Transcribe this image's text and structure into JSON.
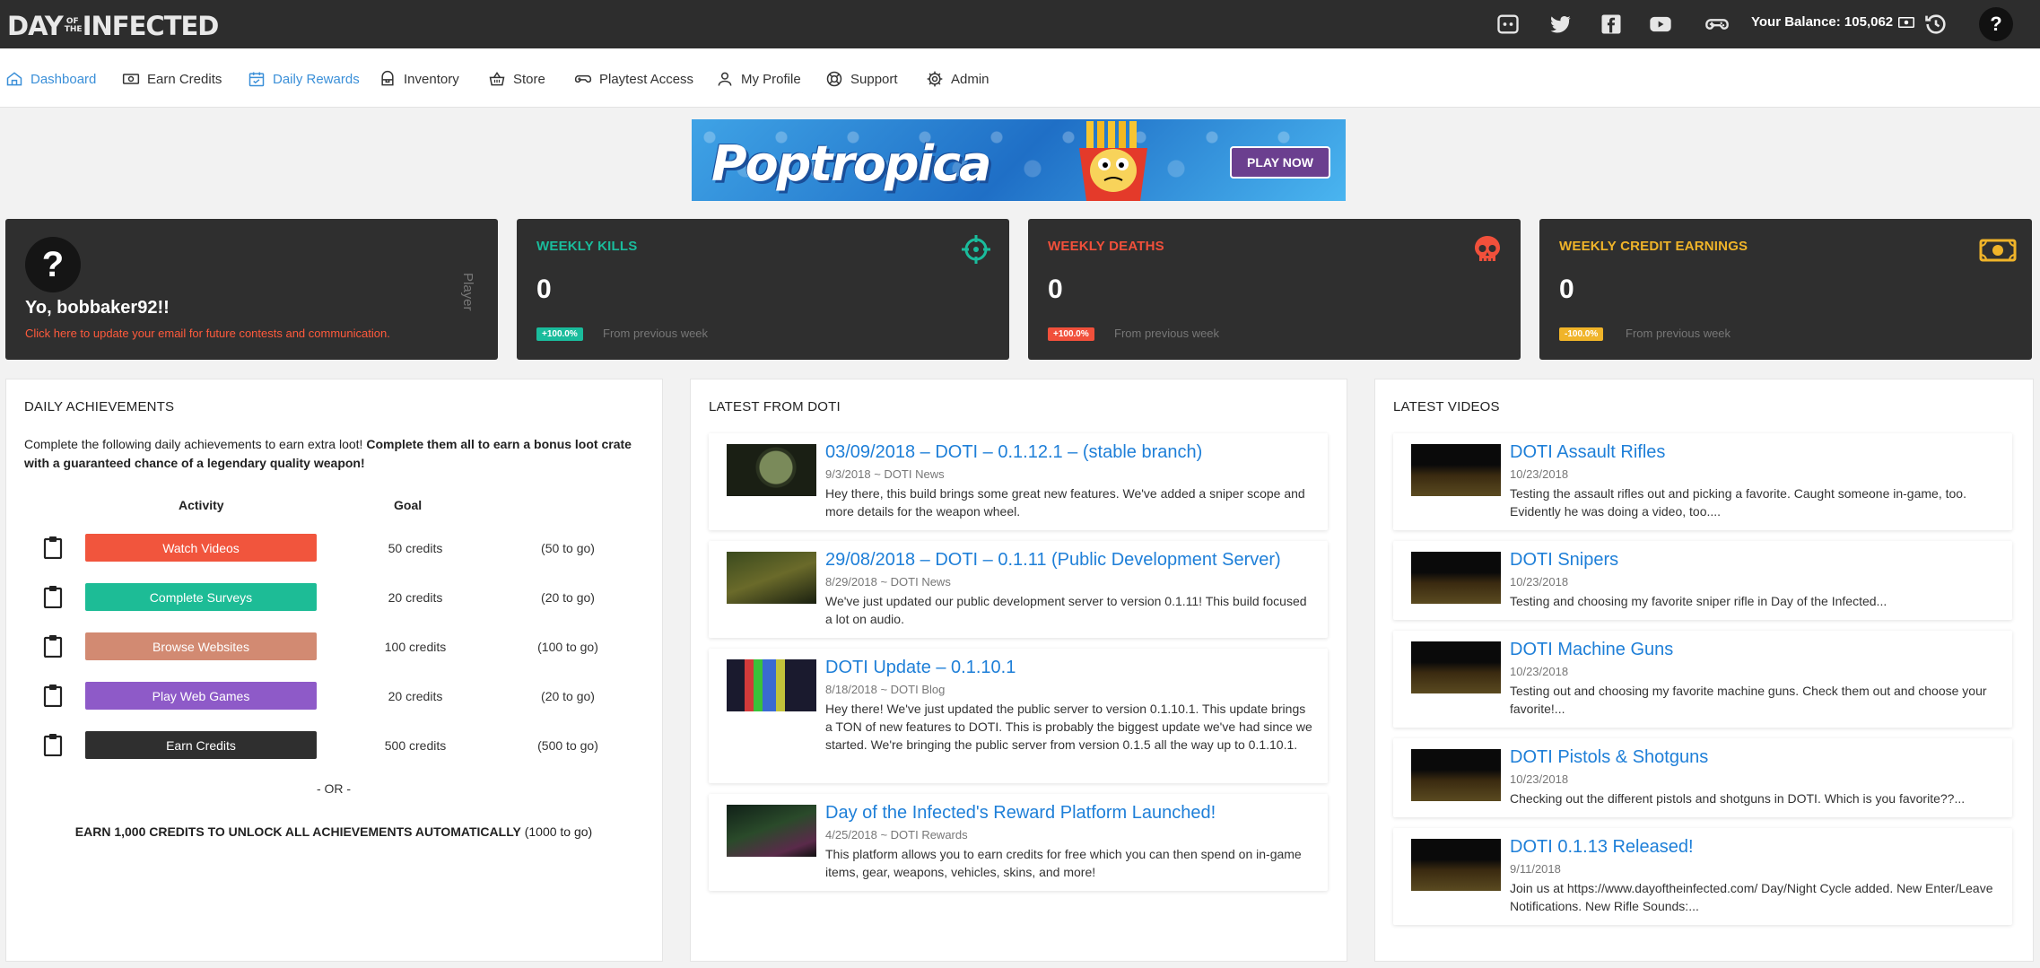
{
  "brand": {
    "logo_left": "DAY",
    "logo_small": "OF THE",
    "logo_right": "INFECTED"
  },
  "topbar": {
    "social_icons": [
      "discord-icon",
      "twitter-icon",
      "facebook-icon",
      "youtube-icon",
      "gamepad-icon"
    ],
    "balance_label": "Your Balance: 105,062",
    "history_icon": "history-icon",
    "help_label": "?"
  },
  "nav": {
    "items": [
      {
        "label": "Dashboard",
        "icon": "home-icon",
        "active": true
      },
      {
        "label": "Earn Credits",
        "icon": "money-icon"
      },
      {
        "label": "Daily Rewards",
        "icon": "calendar-icon"
      },
      {
        "label": "Inventory",
        "icon": "inventory-icon"
      },
      {
        "label": "Store",
        "icon": "basket-icon"
      },
      {
        "label": "Playtest Access",
        "icon": "gamepad-icon"
      },
      {
        "label": "My Profile",
        "icon": "user-icon"
      },
      {
        "label": "Support",
        "icon": "lifebuoy-icon"
      },
      {
        "label": "Admin",
        "icon": "gear-icon"
      }
    ]
  },
  "banner": {
    "title": "Poptropica",
    "cta": "PLAY NOW"
  },
  "player": {
    "avatar": "?",
    "greeting": "Yo, bobbaker92!!",
    "email_notice": "Click here to update your email for future contests and communication.",
    "vertical_label": "Player"
  },
  "stats": [
    {
      "title": "WEEKLY KILLS",
      "value": "0",
      "badge": "+100.0%",
      "note": "From previous week",
      "color": "#1abc9c",
      "icon": "crosshair-icon"
    },
    {
      "title": "WEEKLY DEATHS",
      "value": "0",
      "badge": "+100.0%",
      "note": "From previous week",
      "color": "#f1503b",
      "icon": "skull-icon"
    },
    {
      "title": "WEEKLY CREDIT EARNINGS",
      "value": "0",
      "badge": "-100.0%",
      "note": "From previous week",
      "color": "#f0b429",
      "icon": "money-icon"
    }
  ],
  "achievements": {
    "title": "DAILY ACHIEVEMENTS",
    "intro_plain": "Complete the following daily achievements to earn extra loot! ",
    "intro_bold": "Complete them all to earn a bonus loot crate with a guaranteed chance of a legendary quality weapon!",
    "col_activity": "Activity",
    "col_goal": "Goal",
    "rows": [
      {
        "label": "Watch Videos",
        "goal": "50 credits",
        "togo": "(50 to go)",
        "color": "#f1553d"
      },
      {
        "label": "Complete Surveys",
        "goal": "20 credits",
        "togo": "(20 to go)",
        "color": "#1dbc96"
      },
      {
        "label": "Browse Websites",
        "goal": "100 credits",
        "togo": "(100 to go)",
        "color": "#d28a72"
      },
      {
        "label": "Play Web Games",
        "goal": "20 credits",
        "togo": "(20 to go)",
        "color": "#8e5ac8"
      },
      {
        "label": "Earn Credits",
        "goal": "500 credits",
        "togo": "(500 to go)",
        "color": "#2f2f2f"
      }
    ],
    "or_label": "- OR -",
    "all_bold": "EARN 1,000 CREDITS TO UNLOCK ALL ACHIEVEMENTS AUTOMATICALLY",
    "all_plain": " (1000 to go)"
  },
  "news": {
    "title": "LATEST FROM DOTI",
    "posts": [
      {
        "title": "03/09/2018 – DOTI – 0.1.12.1 – (stable branch)",
        "meta": "9/3/2018 ~ DOTI News",
        "body": "Hey there, this build brings some great new features. We've added a sniper scope and more details for the weapon wheel."
      },
      {
        "title": "29/08/2018 – DOTI – 0.1.11 (Public Development Server)",
        "meta": "8/29/2018 ~ DOTI News",
        "body": "We've just updated our public development server to version 0.1.11! This build focused a lot on audio."
      },
      {
        "title": "DOTI Update – 0.1.10.1",
        "meta": "8/18/2018 ~ DOTI Blog",
        "body": "Hey there! We've just updated the public server to version 0.1.10.1. This update brings a TON of new features to DOTI. This is probably the biggest update we've had since we started. We're bringing the public server from version 0.1.5 all the way up to 0.1.10.1."
      },
      {
        "title": "Day of the Infected's Reward Platform Launched!",
        "meta": "4/25/2018 ~ DOTI Rewards",
        "body": "This platform allows you to earn credits for free which you can then spend on in-game items, gear, weapons, vehicles, skins, and more!"
      }
    ]
  },
  "videos": {
    "title": "LATEST VIDEOS",
    "posts": [
      {
        "title": "DOTI Assault Rifles",
        "meta": "10/23/2018",
        "body": "Testing the assault rifles out and picking a favorite. Caught someone in-game, too. Evidently he was doing a video, too...."
      },
      {
        "title": "DOTI Snipers",
        "meta": "10/23/2018",
        "body": "Testing and choosing my favorite sniper rifle in Day of the Infected..."
      },
      {
        "title": "DOTI Machine Guns",
        "meta": "10/23/2018",
        "body": "Testing out and choosing my favorite machine guns. Check them out and choose your favorite!..."
      },
      {
        "title": "DOTI Pistols & Shotguns",
        "meta": "10/23/2018",
        "body": "Checking out the different pistols and shotguns in DOTI. Which is you favorite??..."
      },
      {
        "title": "DOTI 0.1.13 Released!",
        "meta": "9/11/2018",
        "body": "Join us at https://www.dayoftheinfected.com/ Day/Night Cycle added. New Enter/Leave Notifications. New Rifle Sounds:..."
      }
    ]
  }
}
